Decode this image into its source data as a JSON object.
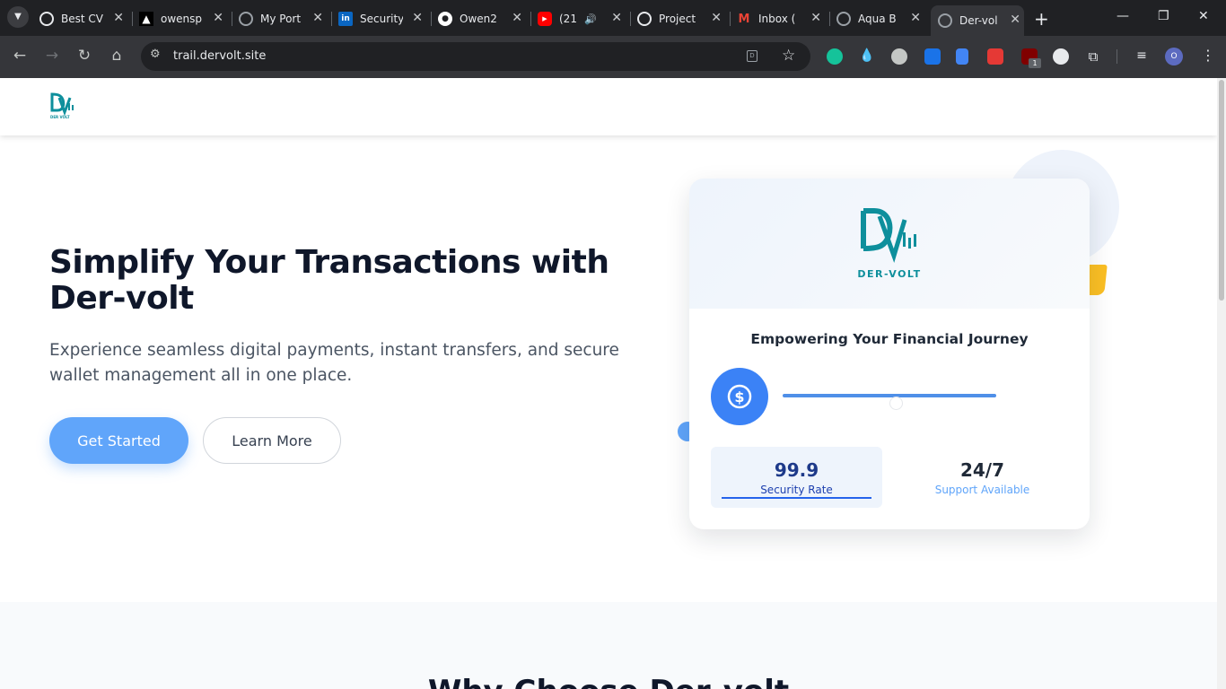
{
  "browser": {
    "tabs": [
      {
        "label": "Best CV",
        "icon": "openai-icon",
        "color": "#e8eaed"
      },
      {
        "label": "owensp",
        "icon": "vercel-icon",
        "color": "#000000"
      },
      {
        "label": "My Port",
        "icon": "globe-icon",
        "color": "#9aa0a6"
      },
      {
        "label": "Security",
        "icon": "linkedin-icon",
        "color": "#0a66c2"
      },
      {
        "label": "Owen2",
        "icon": "github-icon",
        "color": "#ffffff"
      },
      {
        "label": "(21",
        "icon": "youtube-icon",
        "color": "#ff0000"
      },
      {
        "label": "Project",
        "icon": "openai-icon",
        "color": "#e8eaed"
      },
      {
        "label": "Inbox (",
        "icon": "gmail-icon",
        "color": "#ea4335"
      },
      {
        "label": "Aqua B",
        "icon": "globe-icon",
        "color": "#9aa0a6"
      },
      {
        "label": "Der-vol",
        "icon": "globe-icon",
        "color": "#9aa0a6"
      }
    ],
    "url": "trail.dervolt.site",
    "profile_initial": "O",
    "ext_badge": "1"
  },
  "site": {
    "logo_text": "DER VOLT",
    "hero": {
      "title": "Simplify Your Transactions with Der-volt",
      "subtitle": "Experience seamless digital payments, instant transfers, and secure wallet management all in one place.",
      "primary_button": "Get Started",
      "secondary_button": "Learn More"
    },
    "card": {
      "logo_text": "DER-VOLT",
      "heading": "Empowering Your Financial Journey",
      "progress_fraction": 0.53,
      "stats": [
        {
          "value": "99.9",
          "label": "Security Rate"
        },
        {
          "value": "24/7",
          "label": "Support Available"
        }
      ]
    },
    "section2": {
      "title": "Why Choose Der-volt"
    }
  },
  "colors": {
    "brand_teal": "#0e8f9c",
    "accent_blue": "#60a5fa",
    "primary_blue": "#3b82f6",
    "yellow": "#fbbf24"
  }
}
